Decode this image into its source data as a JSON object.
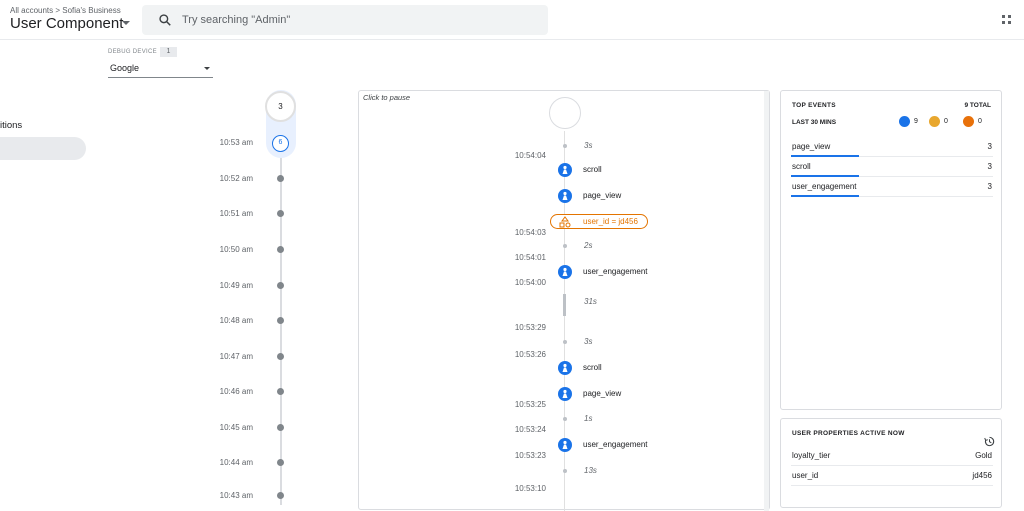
{
  "header": {
    "breadcrumb": "All accounts > Sofia's Business",
    "account": "User Component",
    "search_placeholder": "Try searching \"Admin\""
  },
  "sidebar": {
    "item_label": "itions"
  },
  "debug_device": {
    "label": "DEBUG DEVICE",
    "count": "1",
    "selected": "Google"
  },
  "minutes": {
    "top_count": "3",
    "current_count": "6",
    "rows": [
      "10:53 am",
      "10:52 am",
      "10:51 am",
      "10:50 am",
      "10:49 am",
      "10:48 am",
      "10:47 am",
      "10:46 am",
      "10:45 am",
      "10:44 am",
      "10:43 am"
    ]
  },
  "stream": {
    "pause_label": "Click to pause",
    "gaps": [
      "3s",
      "2s",
      "31s",
      "3s",
      "1s",
      "13s"
    ],
    "times": [
      "10:54:04",
      "10:54:03",
      "10:54:01",
      "10:54:00",
      "10:53:29",
      "10:53:26",
      "10:53:25",
      "10:53:24",
      "10:53:23",
      "10:53:10"
    ],
    "events": [
      "scroll",
      "page_view",
      "user_engagement",
      "scroll",
      "page_view",
      "user_engagement"
    ],
    "user_prop": "user_id = jd456"
  },
  "top_events": {
    "title": "TOP EVENTS",
    "total": "9 TOTAL",
    "period": "LAST 30 MINS",
    "counts": {
      "events": "9",
      "conversions": "0",
      "errors": "0"
    },
    "colors": {
      "events": "#1a73e8",
      "conversions": "#e8a72e",
      "errors": "#e8710a"
    },
    "rows": [
      {
        "name": "page_view",
        "count": "3"
      },
      {
        "name": "scroll",
        "count": "3"
      },
      {
        "name": "user_engagement",
        "count": "3"
      }
    ]
  },
  "user_properties": {
    "title": "USER PROPERTIES ACTIVE NOW",
    "rows": [
      {
        "key": "loyalty_tier",
        "value": "Gold"
      },
      {
        "key": "user_id",
        "value": "jd456"
      }
    ]
  }
}
